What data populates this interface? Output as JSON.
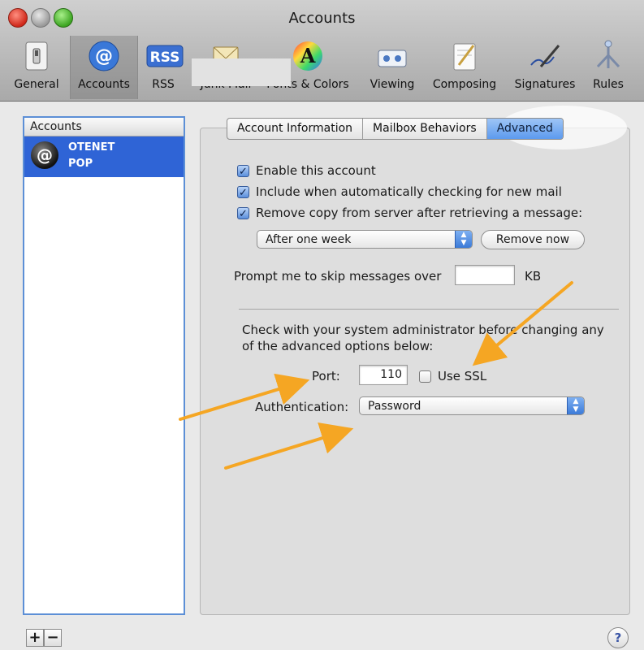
{
  "window": {
    "title": "Accounts"
  },
  "toolbar": {
    "items": [
      {
        "label": "General",
        "icon": "light-switch-icon"
      },
      {
        "label": "Accounts",
        "icon": "at-sign-icon",
        "selected": true
      },
      {
        "label": "RSS",
        "icon": "rss-icon",
        "icon_text": "RSS"
      },
      {
        "label": "Junk Mail",
        "icon": "junk-mail-icon"
      },
      {
        "label": "Fonts & Colors",
        "icon": "color-font-icon",
        "icon_text": "A"
      },
      {
        "label": "Viewing",
        "icon": "viewing-icon"
      },
      {
        "label": "Composing",
        "icon": "composing-icon"
      },
      {
        "label": "Signatures",
        "icon": "signature-pen-icon"
      },
      {
        "label": "Rules",
        "icon": "rules-icon"
      }
    ]
  },
  "accounts_list": {
    "header": "Accounts",
    "items": [
      {
        "name": "OTENET",
        "type": "POP",
        "icon": "at-sign-icon"
      }
    ]
  },
  "list_controls": {
    "add": "+",
    "remove": "−"
  },
  "tabs": [
    {
      "label": "Account Information"
    },
    {
      "label": "Mailbox Behaviors"
    },
    {
      "label": "Advanced",
      "active": true
    }
  ],
  "advanced": {
    "enable_account": {
      "label": "Enable this account",
      "checked": true
    },
    "include_checking": {
      "label": "Include when automatically checking for new mail",
      "checked": true
    },
    "remove_copy": {
      "label": "Remove copy from server after retrieving a message:",
      "checked": true
    },
    "remove_after": {
      "value": "After one week"
    },
    "remove_now_button": "Remove now",
    "prompt_skip": {
      "label": "Prompt me to skip messages over",
      "value": "",
      "unit": "KB"
    },
    "note": "Check with your system administrator before changing any of the advanced options below:",
    "port": {
      "label": "Port:",
      "value": "110"
    },
    "use_ssl": {
      "label": "Use SSL",
      "checked": false
    },
    "authentication": {
      "label": "Authentication:",
      "value": "Password"
    }
  },
  "help_button": "?",
  "colors": {
    "selection_blue": "#2f64d6",
    "tab_active": "#5c9aee",
    "annotation_arrow": "#f5a623"
  }
}
